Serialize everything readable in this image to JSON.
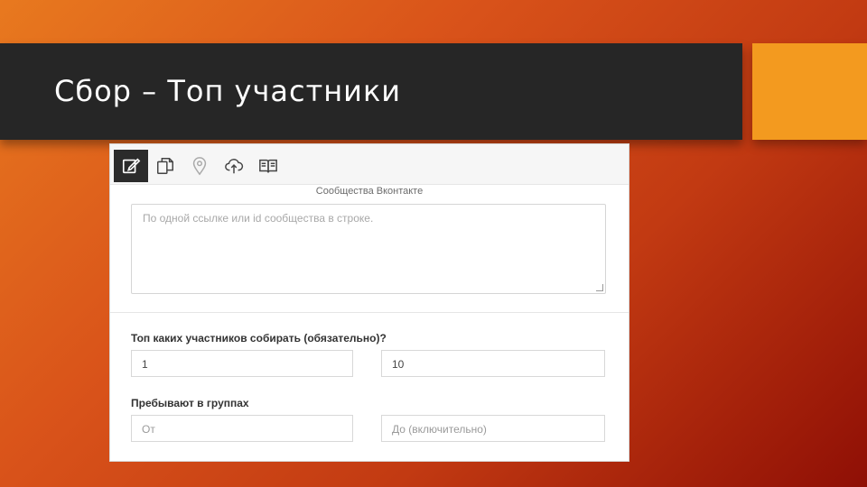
{
  "slide": {
    "title": "Сбор – Топ участники"
  },
  "toolbar": {
    "icons": [
      "edit-icon",
      "copy-icon",
      "location-pin-icon",
      "cloud-upload-icon",
      "book-icon"
    ],
    "active_index": 0
  },
  "communities": {
    "title": "Сообщества Вконтакте",
    "placeholder": "По одной ссылке или id сообщества в строке."
  },
  "top_members": {
    "label": "Топ каких участников собирать (обязательно)?",
    "from_value": "1",
    "to_value": "10"
  },
  "groups_count": {
    "label": "Пребывают в группах",
    "from_placeholder": "От",
    "to_placeholder": "До (включительно)"
  },
  "colors": {
    "title_bar": "#262626",
    "accent": "#f39a1f",
    "active_tool": "#2b2b2b"
  }
}
